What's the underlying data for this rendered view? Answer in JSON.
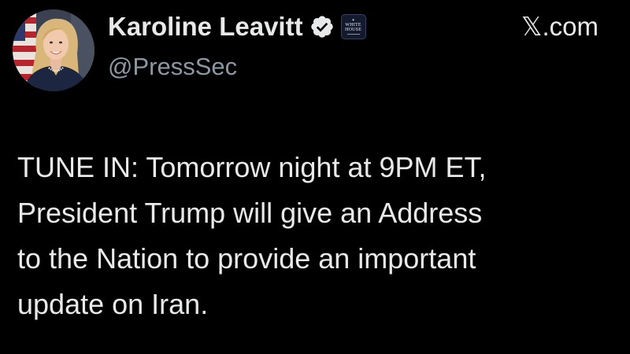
{
  "author": {
    "display_name": "Karoline Leavitt",
    "handle": "@PressSec",
    "avatar_icon": "profile-photo-avatar",
    "verified_icon": "verified-check-badge-icon",
    "verified_color": "#1d9bf0",
    "affiliate_badge": {
      "icon": "white-house-affiliate-badge",
      "label_line1": "WHITE",
      "label_line2": "HOUSE"
    }
  },
  "source": {
    "label": "𝕏.com"
  },
  "tweet": {
    "lines": [
      "TUNE IN: Tomorrow night at 9PM ET,",
      "President Trump will give an Address",
      "to the Nation to provide an important",
      "update on Iran."
    ]
  },
  "colors": {
    "background": "#000000",
    "primary_text": "#e7e9ea",
    "secondary_text": "#8b98a5"
  }
}
